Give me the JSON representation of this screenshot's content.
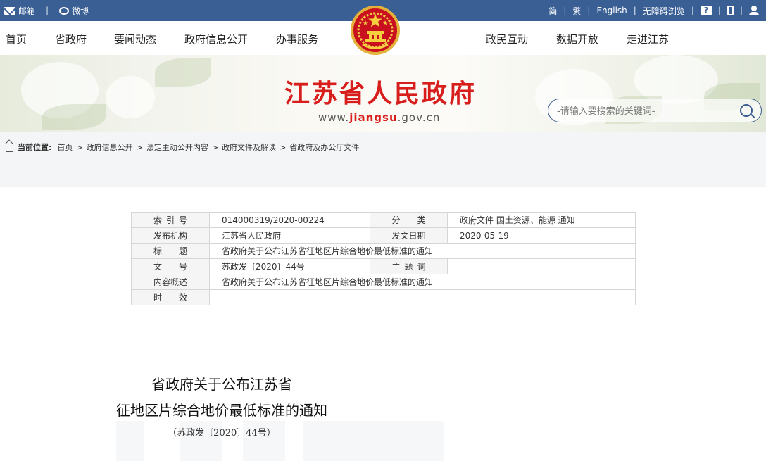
{
  "topbar": {
    "mail": "邮箱",
    "weibo": "微博",
    "simplified": "简",
    "traditional": "繁",
    "english": "English",
    "accessible": "无障碍浏览"
  },
  "nav": {
    "items": [
      "首页",
      "省政府",
      "要闻动态",
      "政府信息公开",
      "办事服务",
      "政民互动",
      "数据开放",
      "走进江苏"
    ]
  },
  "header": {
    "site_title": "江苏省人民政府",
    "url_prefix": "www.",
    "url_domain": "jiangsu",
    "url_suffix": ".gov.cn",
    "search_placeholder": "-请输入要搜索的关键词-"
  },
  "breadcrumb": {
    "label": "当前位置:",
    "items": [
      "首页",
      "政府信息公开",
      "法定主动公开内容",
      "政府文件及解读",
      "省政府及办公厅文件"
    ]
  },
  "meta": {
    "index_label": "索引号",
    "index_value": "014000319/2020-00224",
    "category_label": "分　　类",
    "category_value": "政府文件 国土资源、能源 通知",
    "publisher_label": "发布机构",
    "publisher_value": "江苏省人民政府",
    "date_label": "发文日期",
    "date_value": "2020-05-19",
    "title_label": "标题",
    "title_value": "省政府关于公布江苏省征地区片综合地价最低标准的通知",
    "docno_label": "文号",
    "docno_value": "苏政发〔2020〕44号",
    "keywords_label": "主题词",
    "keywords_value": "",
    "summary_label": "内容概述",
    "summary_value": "省政府关于公布江苏省征地区片综合地价最低标准的通知",
    "validity_label": "时效",
    "validity_value": ""
  },
  "document": {
    "title_line1": "省政府关于公布江苏省",
    "title_line2": "征地区片综合地价最低标准的通知",
    "doc_number": "（苏政发〔2020〕44号）"
  },
  "colors": {
    "topbar": "#3a5f95",
    "title_red": "#d71e1c",
    "crumb_bg": "#f3f5f7"
  }
}
